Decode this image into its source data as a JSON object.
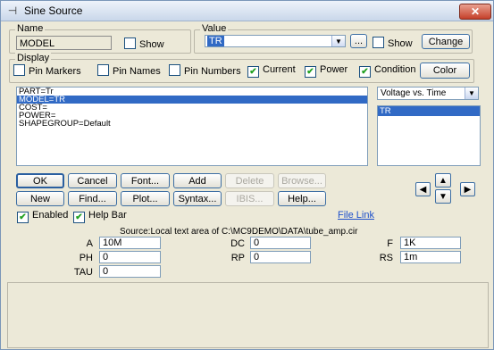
{
  "window": {
    "title": "Sine Source",
    "close_glyph": "✕",
    "app_icon": "component-icon"
  },
  "name_group": {
    "legend": "Name",
    "value": "MODEL",
    "show_label": "Show",
    "show_checked": false
  },
  "value_group": {
    "legend": "Value",
    "value": "TR",
    "ellipsis_label": "...",
    "show_label": "Show",
    "show_checked": false,
    "change_label": "Change"
  },
  "display_group": {
    "legend": "Display",
    "options": [
      {
        "label": "Pin Markers",
        "checked": false
      },
      {
        "label": "Pin Names",
        "checked": false
      },
      {
        "label": "Pin Numbers",
        "checked": false
      },
      {
        "label": "Current",
        "checked": true
      },
      {
        "label": "Power",
        "checked": true
      },
      {
        "label": "Condition",
        "checked": true
      }
    ],
    "color_label": "Color"
  },
  "attributes_list": [
    "PART=Tr",
    "MODEL=TR",
    "COST=",
    "POWER=",
    "SHAPEGROUP=Default"
  ],
  "attributes_selected_index": 1,
  "plot_select": {
    "value": "Voltage vs. Time"
  },
  "model_list": [
    "TR"
  ],
  "model_selected_index": 0,
  "buttons_row1": [
    {
      "label": "OK",
      "enabled": true
    },
    {
      "label": "Cancel",
      "enabled": true
    },
    {
      "label": "Font...",
      "enabled": true
    },
    {
      "label": "Add",
      "enabled": true
    },
    {
      "label": "Delete",
      "enabled": false
    },
    {
      "label": "Browse...",
      "enabled": false
    }
  ],
  "buttons_row2": [
    {
      "label": "New",
      "enabled": true
    },
    {
      "label": "Find...",
      "enabled": true
    },
    {
      "label": "Plot...",
      "enabled": true
    },
    {
      "label": "Syntax...",
      "enabled": true
    },
    {
      "label": "IBIS...",
      "enabled": false
    },
    {
      "label": "Help...",
      "enabled": true
    }
  ],
  "arrows": {
    "up": "▲",
    "down": "▼",
    "left": "◀",
    "right": "▶"
  },
  "enabled": {
    "label": "Enabled",
    "checked": true
  },
  "help_bar": {
    "label": "Help Bar",
    "checked": true
  },
  "file_link": "File Link",
  "source_text": "Source:Local text area of C:\\MC9DEMO\\DATA\\tube_amp.cir",
  "params": [
    {
      "name": "A",
      "value": "10M"
    },
    {
      "name": "DC",
      "value": "0"
    },
    {
      "name": "F",
      "value": "1K"
    },
    {
      "name": "PH",
      "value": "0"
    },
    {
      "name": "RP",
      "value": "0"
    },
    {
      "name": "RS",
      "value": "1m"
    },
    {
      "name": "TAU",
      "value": "0"
    }
  ],
  "colors": {
    "selection": "#316ac5",
    "dialog_bg": "#ece9d8",
    "check": "#21a121"
  }
}
